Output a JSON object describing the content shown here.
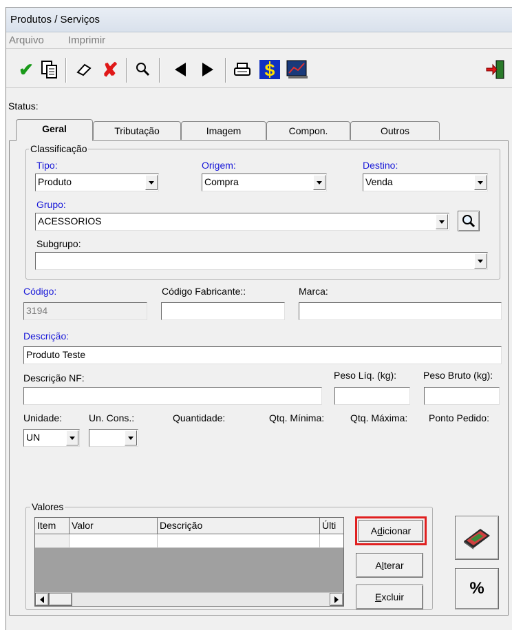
{
  "window": {
    "title": "Produtos / Serviços"
  },
  "menu": {
    "arquivo": "Arquivo",
    "imprimir": "Imprimir"
  },
  "status": {
    "label": "Status:"
  },
  "tabs": [
    "Geral",
    "Tributação",
    "Imagem",
    "Compon.",
    "Outros"
  ],
  "classificacao": {
    "title": "Classificação",
    "tipo_label": "Tipo:",
    "tipo_value": "Produto",
    "origem_label": "Origem:",
    "origem_value": "Compra",
    "destino_label": "Destino:",
    "destino_value": "Venda",
    "grupo_label": "Grupo:",
    "grupo_value": "ACESSORIOS",
    "subgrupo_label": "Subgrupo:",
    "subgrupo_value": ""
  },
  "fields": {
    "codigo_label": "Código:",
    "codigo_value": "3194",
    "cod_fab_label": "Código Fabricante::",
    "cod_fab_value": "",
    "marca_label": "Marca:",
    "marca_value": "",
    "descricao_label": "Descrição:",
    "descricao_value": "Produto Teste",
    "descricao_nf_label": "Descrição NF:",
    "descricao_nf_value": "",
    "peso_liq_label": "Peso Líq. (kg):",
    "peso_liq_value": "",
    "peso_bruto_label": "Peso Bruto (kg):",
    "peso_bruto_value": "",
    "unidade_label": "Unidade:",
    "unidade_value": "UN",
    "un_cons_label": "Un. Cons.:",
    "un_cons_value": "",
    "quantidade_label": "Quantidade:",
    "qtd_min_label": "Qtq. Mínima:",
    "qtd_max_label": "Qtq. Máxima:",
    "ponto_pedido_label": "Ponto Pedido:"
  },
  "valores": {
    "title": "Valores",
    "columns": [
      "Item",
      "Valor",
      "Descrição",
      "Últi"
    ],
    "buttons": {
      "adicionar": {
        "pre": "A",
        "u": "d",
        "post": "icionar"
      },
      "alterar": {
        "pre": "A",
        "u": "l",
        "post": "terar"
      },
      "excluir": {
        "pre": "",
        "u": "E",
        "post": "xcluir"
      }
    },
    "percent_label": "%"
  },
  "icons": {
    "confirm": "checkmark-icon",
    "copy": "copy-icon",
    "edit": "eraser-icon",
    "cancel": "red-x-icon",
    "search": "magnifier-icon",
    "prev": "left-triangle-icon",
    "next": "right-triangle-icon",
    "print": "printer-icon",
    "price": "dollar-icon",
    "chart": "chart-icon",
    "exit": "exit-door-icon"
  },
  "colors": {
    "highlight": "#e02020",
    "label_blue": "#1818d8"
  }
}
